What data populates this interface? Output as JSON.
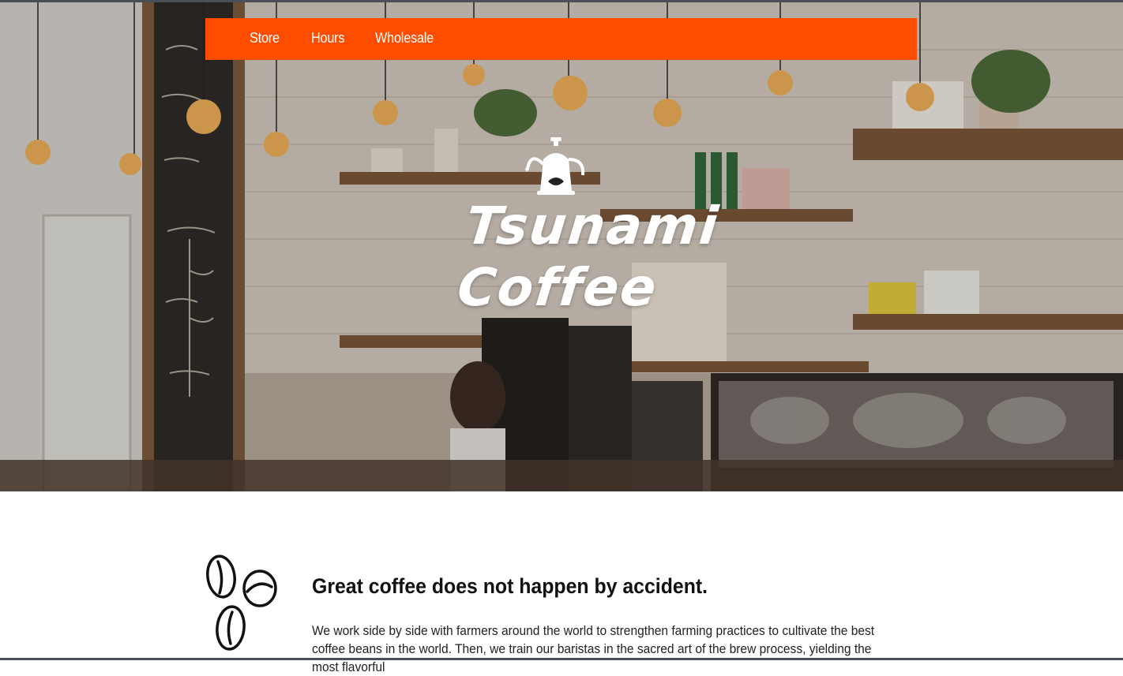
{
  "nav": {
    "items": [
      {
        "label": "Store"
      },
      {
        "label": "Hours"
      },
      {
        "label": "Wholesale"
      }
    ],
    "background_color": "#ff4d00"
  },
  "hero": {
    "brand_line1": "Tsunami",
    "brand_line2": "Coffee",
    "logo_icon": "pour-over-kettle-icon",
    "text_color": "#ffffff"
  },
  "intro": {
    "icon": "coffee-beans-icon",
    "headline": "Great coffee does not happen by accident.",
    "body": "We work side by side with farmers around the world to strengthen farming practices to cultivate the best coffee beans in the world. Then, we train our baristas in the sacred art of the brew process, yielding the most flavorful"
  }
}
